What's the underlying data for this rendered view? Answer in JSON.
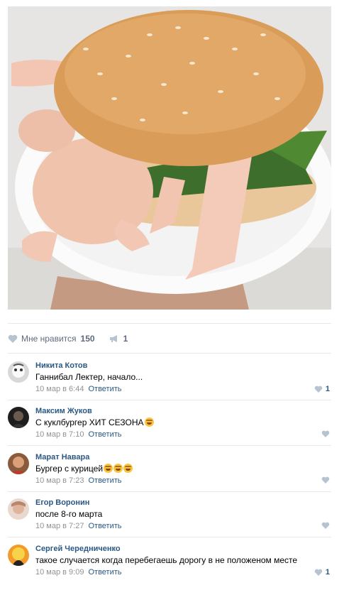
{
  "post": {
    "photo_description_icon": "burger-photo",
    "likes_label": "Мне нравится",
    "likes_count": "150",
    "shares_count": "1"
  },
  "comments": [
    {
      "author": "Никита Котов",
      "text": "Ганнибал Лектер, начало...",
      "date": "10 мар в 6:44",
      "reply": "Ответить",
      "likes": "1"
    },
    {
      "author": "Максим Жуков",
      "text": "С куклбургер ХИТ СЕЗОНА",
      "date": "10 мар в 7:10",
      "reply": "Ответить",
      "likes": ""
    },
    {
      "author": "Марат Навара",
      "text": "Бургер с курицей",
      "date": "10 мар в 7:23",
      "reply": "Ответить",
      "likes": ""
    },
    {
      "author": "Егор Воронин",
      "text": "после 8-го марта",
      "date": "10 мар в 7:27",
      "reply": "Ответить",
      "likes": ""
    },
    {
      "author": "Сергей Чередниченко",
      "text": "такое случается когда перебегаешь дорогу в не положеном месте",
      "date": "10 мар в 9:09",
      "reply": "Ответить",
      "likes": "1"
    }
  ],
  "colors": {
    "link": "#2a5885",
    "muted": "#939393",
    "icon": "#b7c3d1"
  }
}
